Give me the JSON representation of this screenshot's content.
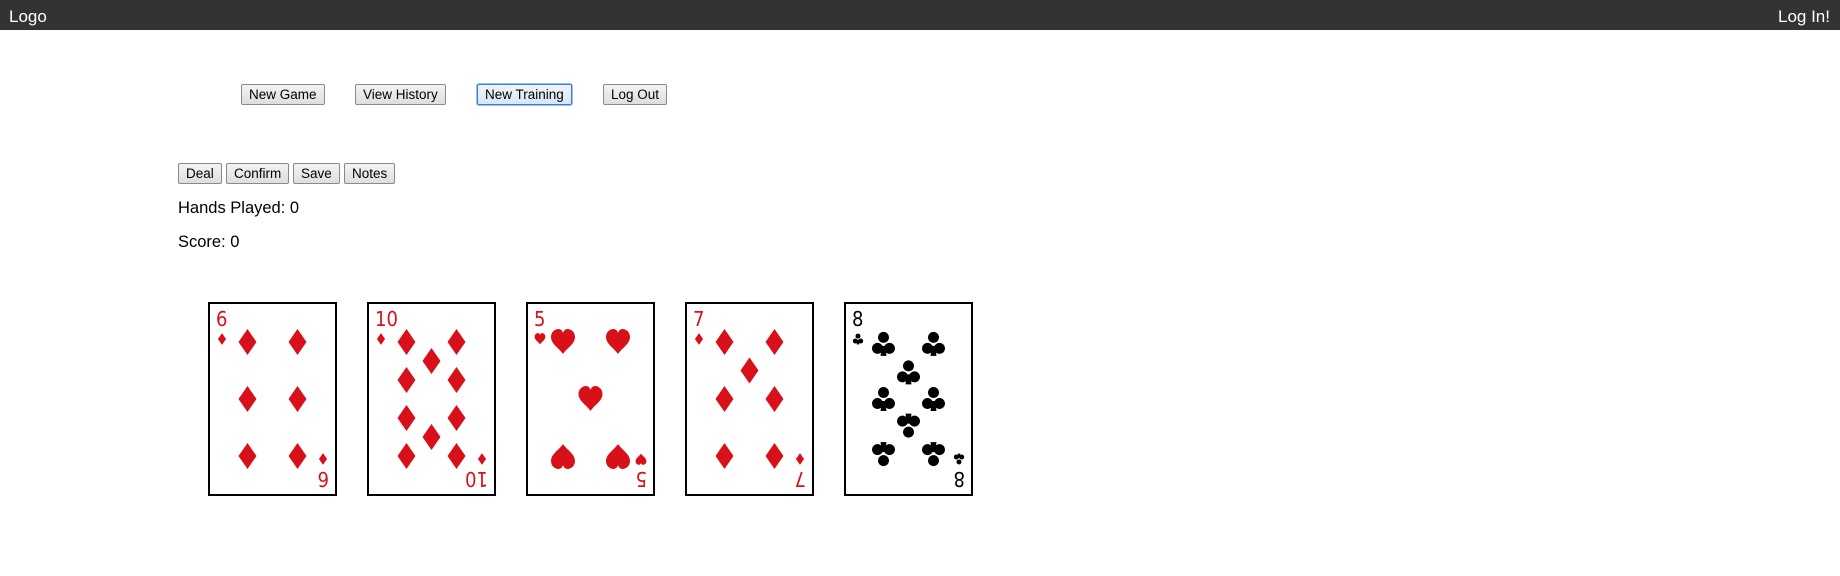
{
  "header": {
    "logo": "Logo",
    "login": "Log In!"
  },
  "nav": {
    "new_game": "New Game",
    "view_history": "View History",
    "new_training": "New Training",
    "log_out": "Log Out"
  },
  "game": {
    "deal": "Deal",
    "confirm": "Confirm",
    "save": "Save",
    "notes": "Notes",
    "hands_played": "Hands Played: 0",
    "score": "Score: 0"
  },
  "cards": [
    {
      "rank": "6",
      "suit": "diamonds",
      "color": "#d8101a"
    },
    {
      "rank": "10",
      "suit": "diamonds",
      "color": "#d8101a"
    },
    {
      "rank": "5",
      "suit": "hearts",
      "color": "#d8101a"
    },
    {
      "rank": "7",
      "suit": "diamonds",
      "color": "#d8101a"
    },
    {
      "rank": "8",
      "suit": "clubs",
      "color": "#000000"
    }
  ],
  "colors": {
    "header_bg": "#333333",
    "header_text": "#ffffff",
    "red_suit": "#d8101a",
    "black_suit": "#000000"
  }
}
